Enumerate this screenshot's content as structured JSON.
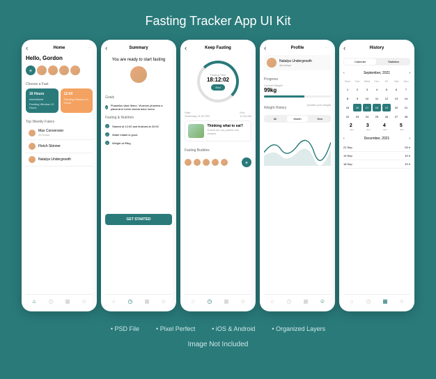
{
  "title": "Fasting Tracker App UI Kit",
  "features": [
    "PSD File",
    "Pixel Perfect",
    "iOS & Android",
    "Organized Layers"
  ],
  "disclaimer": "Image Not Included",
  "screen1": {
    "title": "Home",
    "greeting": "Hello, Gordon",
    "choose_label": "Choose a Fast",
    "card1_title": "16 Hours",
    "card1_sub": "Intermittent",
    "card1_detail": "Feeding Window 12 Hours",
    "card2_title": "12:00",
    "card2_sub": "Feeding Window 24 Hours",
    "top_label": "Top Weekly Faters",
    "fasters": [
      {
        "name": "Max Conversion",
        "sub": "20 Hours"
      },
      {
        "name": "Fletch Skinner",
        "sub": ""
      },
      {
        "name": "Natalya Undergrowth",
        "sub": ""
      }
    ]
  },
  "screen2": {
    "title": "Summary",
    "hero": "You are ready to start fasting",
    "goals_label": "Goals",
    "goal_text": "Phasellus vitae libero. Vivamus pharetra a placerat in lorem lacinia dolor lorem",
    "nutrition_label": "Fasting & Nutrition",
    "items": [
      "Started at 12:00 and finished at 20:00",
      "Water intake is good",
      "Weight at 99kg"
    ],
    "cta": "GET STARTED"
  },
  "screen3": {
    "title": "Keep Fasting",
    "timer_label": "Fasting Time",
    "timer_value": "18:12:02",
    "end_label": "End",
    "start_label": "Start",
    "start_time": "Yesterday 11:00 PM",
    "end_label2": "End",
    "end_time": "11:00 AM",
    "article_title": "Thinking what to eat?",
    "article_sub": "Check out our protein rich recipes",
    "buddies_label": "Fasting Buddies"
  },
  "screen4": {
    "title": "Profile",
    "name": "Natalya Undergrowth",
    "handle": "@natalya",
    "progress_label": "Progress",
    "weight_label": "Current Weight",
    "weight": "99kg",
    "history_label": "Weight History",
    "update_label": "Update your weight",
    "tabs": [
      "All",
      "Month",
      "Year"
    ]
  },
  "screen5": {
    "title": "History",
    "tabs": [
      "Calendar",
      "Statistics"
    ],
    "month": "September, 2021",
    "days": [
      "Mon",
      "Tue",
      "Wed",
      "Thu",
      "Fri",
      "Sat",
      "Sun"
    ],
    "stats": [
      {
        "num": "2",
        "label": "days"
      },
      {
        "num": "3",
        "label": "days"
      },
      {
        "num": "4",
        "label": "days"
      },
      {
        "num": "5",
        "label": "days"
      }
    ],
    "month2": "December, 2021",
    "hist": [
      {
        "d": "21 Sep",
        "h": "03 h"
      },
      {
        "d": "19 Sep",
        "h": "19 h"
      },
      {
        "d": "18 Sep",
        "h": "19 h"
      }
    ]
  }
}
